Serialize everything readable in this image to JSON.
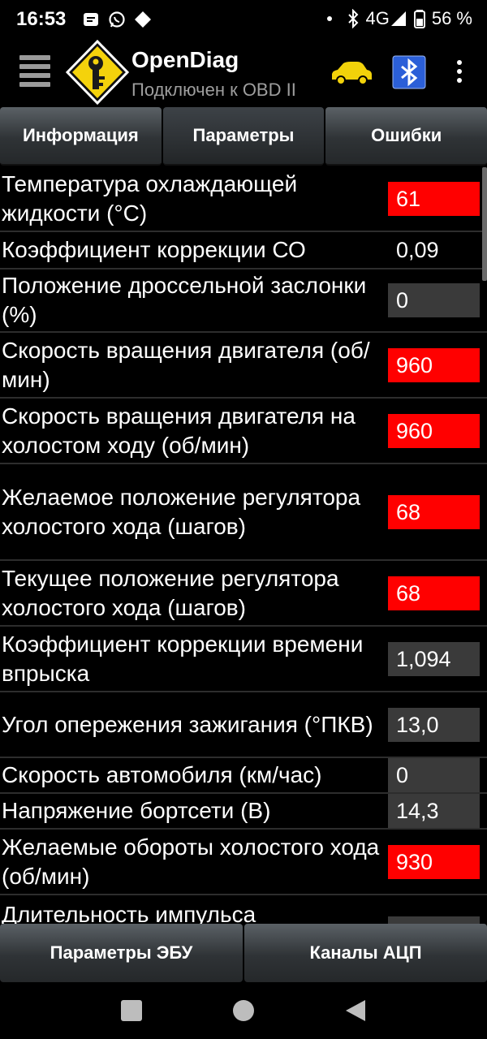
{
  "status_bar": {
    "time": "16:53",
    "network": "4G",
    "battery": "56 %",
    "icons": [
      "message-icon",
      "whatsapp-icon",
      "diamond-icon",
      "dot-icon",
      "bluetooth-icon",
      "signal-icon",
      "battery-icon"
    ]
  },
  "app_bar": {
    "title": "OpenDiag",
    "subtitle": "Подключен к OBD II",
    "icons": [
      "menu-icon",
      "app-logo-icon",
      "car-icon",
      "bluetooth-icon",
      "overflow-menu-icon"
    ]
  },
  "tabs": [
    {
      "label": "Информация"
    },
    {
      "label": "Параметры",
      "active": true
    },
    {
      "label": "Ошибки"
    }
  ],
  "parameters": [
    {
      "label": "Температура охлаждающей жидкости (°C)",
      "value": "61",
      "style": "alert"
    },
    {
      "label": "Коэффициент коррекции СО",
      "value": "0,09",
      "style": "plain"
    },
    {
      "label": "Положение дроссельной заслонки (%)",
      "value": "0",
      "style": "normal"
    },
    {
      "label": "Скорость вращения двигателя (об/мин)",
      "value": "960",
      "style": "alert"
    },
    {
      "label": "Скорость вращения двигателя на холостом ходу (об/мин)",
      "value": "960",
      "style": "alert"
    },
    {
      "label": "Желаемое положение регулятора холостого хода (шагов)",
      "value": "68",
      "style": "alert"
    },
    {
      "label": "Текущее положение регулятора холостого хода (шагов)",
      "value": "68",
      "style": "alert"
    },
    {
      "label": "Коэффициент коррекции времени впрыска",
      "value": "1,094",
      "style": "normal"
    },
    {
      "label": "Угол опережения зажигания (°ПКВ)",
      "value": "13,0",
      "style": "normal"
    },
    {
      "label": "Скорость автомобиля (км/час)",
      "value": "0",
      "style": "normal"
    },
    {
      "label": "Напряжение бортсети (В)",
      "value": "14,3",
      "style": "normal"
    },
    {
      "label": "Желаемые обороты холостого хода (об/мин)",
      "value": "930",
      "style": "alert"
    },
    {
      "label": "Длительность импульса",
      "value": "",
      "style": "normal"
    }
  ],
  "bottom_buttons": [
    {
      "label": "Параметры ЭБУ"
    },
    {
      "label": "Каналы АЦП"
    }
  ],
  "colors": {
    "alert": "#ff0000",
    "value_bg": "#3a3a3a",
    "background": "#000000",
    "button_top": "#5b6166",
    "button_bottom": "#25282a",
    "subtitle": "#9e9e9e"
  }
}
